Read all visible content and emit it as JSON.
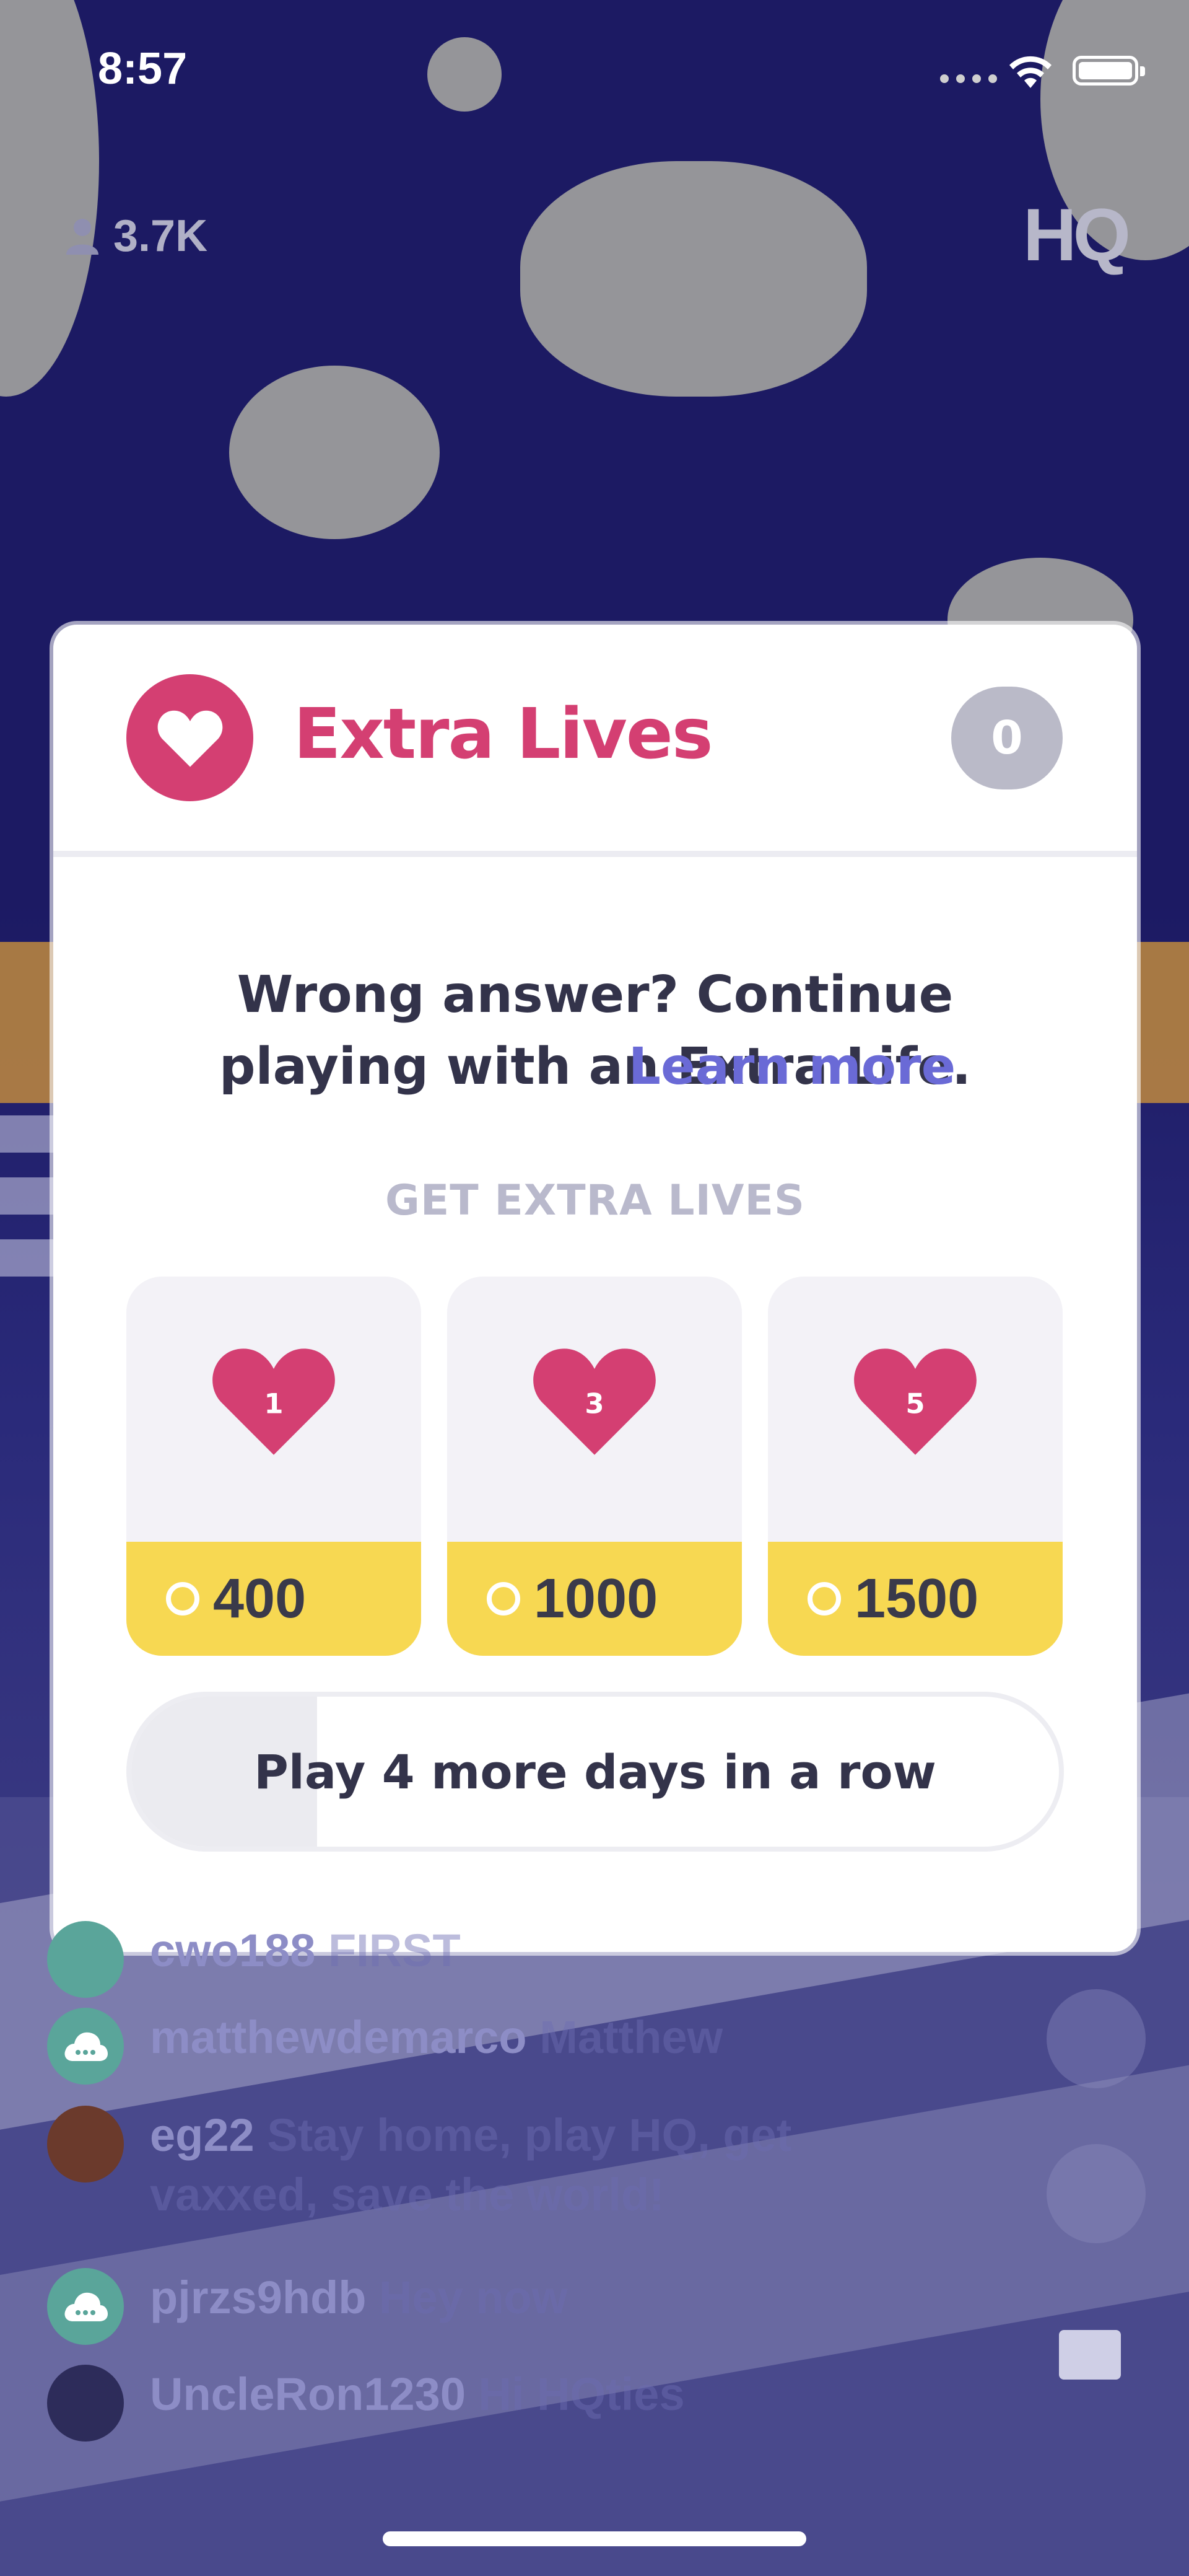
{
  "status_bar": {
    "time": "8:57"
  },
  "stream": {
    "viewer_count": "3.7K",
    "logo": "HQ"
  },
  "modal": {
    "title": "Extra Lives",
    "lives_count": "0",
    "description": "Wrong answer? Continue playing with an Extra Life.",
    "learn_more": "Learn more",
    "section_label": "GET EXTRA LIVES",
    "packs": [
      {
        "lives": "1",
        "price": "400"
      },
      {
        "lives": "3",
        "price": "1000"
      },
      {
        "lives": "5",
        "price": "1500"
      }
    ],
    "streak": {
      "label": "Play 4 more days in a row",
      "progress": 0.2
    }
  },
  "chat": [
    {
      "user": "cwo188",
      "message": "FIRST"
    },
    {
      "user": "matthewdemarco",
      "message": "Matthew"
    },
    {
      "user": "eg22",
      "message": "Stay home, play HQ, get vaxxed, save the world!"
    },
    {
      "user": "pjrzs9hdb",
      "message": "Hey now"
    },
    {
      "user": "UncleRon1230",
      "message": "Hi HQties"
    }
  ],
  "colors": {
    "accent": "#d43f72",
    "link": "#6a6ad6",
    "coin": "#f7d852"
  }
}
